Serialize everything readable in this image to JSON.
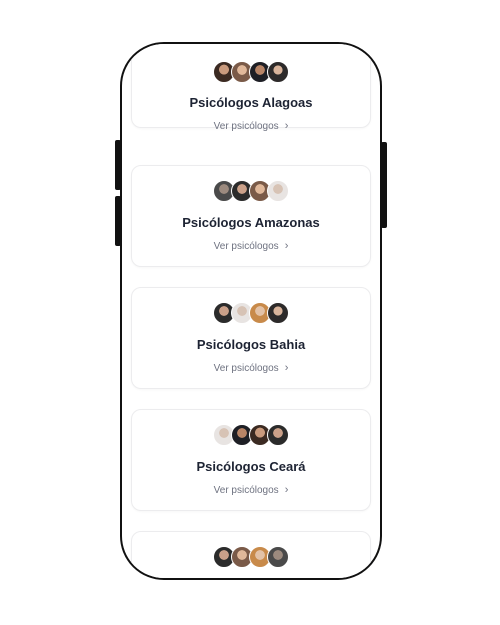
{
  "cards": [
    {
      "title": "Psicólogos Alagoas",
      "link": "Ver psicólogos"
    },
    {
      "title": "Psicólogos Amazonas",
      "link": "Ver psicólogos"
    },
    {
      "title": "Psicólogos Bahia",
      "link": "Ver psicólogos"
    },
    {
      "title": "Psicólogos Ceará",
      "link": "Ver psicólogos"
    },
    {
      "title": "",
      "link": ""
    }
  ],
  "chevron": "›"
}
